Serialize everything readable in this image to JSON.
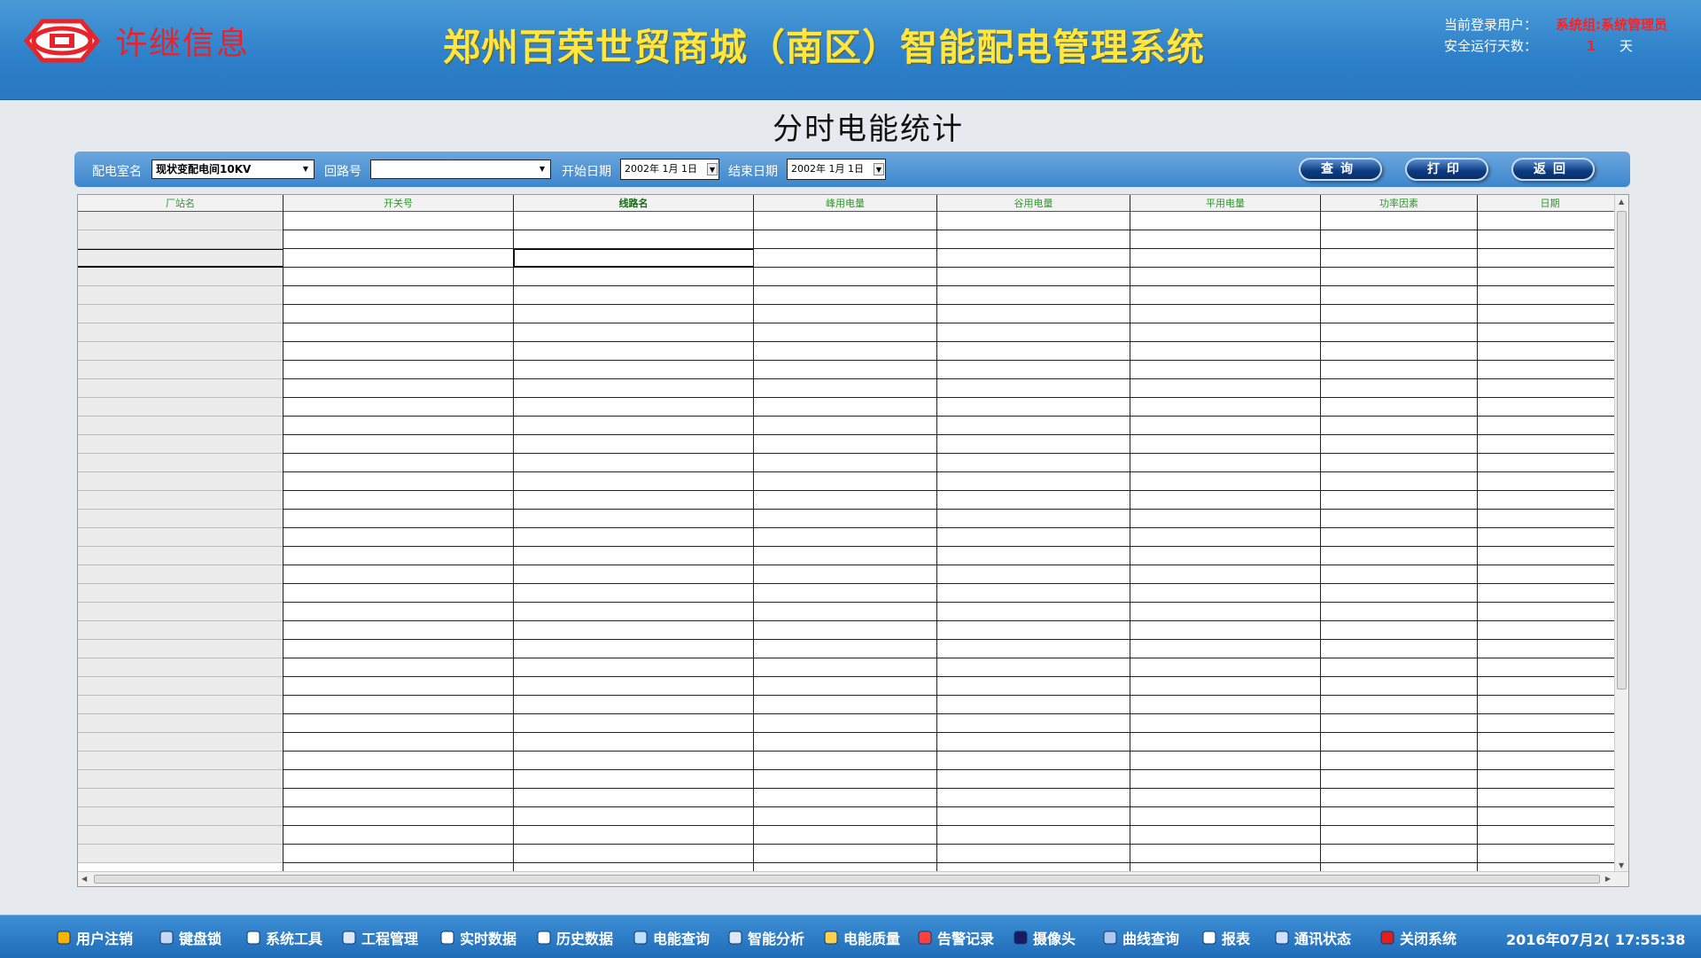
{
  "header": {
    "brand_text": "许继信息",
    "system_title": "郑州百荣世贸商城（南区）智能配电管理系统",
    "login_label": "当前登录用户：",
    "login_value": "系统组:系统管理员",
    "uptime_label": "安全运行天数：",
    "uptime_value": "1",
    "uptime_unit": "天"
  },
  "page_title": "分时电能统计",
  "toolbar": {
    "room_label": "配电室名",
    "room_value": "现状变配电间10KV",
    "circuit_label": "回路号",
    "circuit_value": "",
    "start_label": "开始日期",
    "start_value": "2002年 1月 1日",
    "end_label": "结束日期",
    "end_value": "2002年 1月 1日",
    "query_label": "查询",
    "print_label": "打印",
    "back_label": "返回"
  },
  "table": {
    "columns": [
      "厂站名",
      "开关号",
      "线路名",
      "峰用电量",
      "谷用电量",
      "平用电量",
      "功率因素",
      "日期"
    ]
  },
  "taskbar": {
    "items": [
      {
        "label": "用户注销",
        "icon": "user-icon"
      },
      {
        "label": "键盘锁",
        "icon": "keyboard-icon"
      },
      {
        "label": "系统工具",
        "icon": "tools-icon"
      },
      {
        "label": "工程管理",
        "icon": "project-icon"
      },
      {
        "label": "实时数据",
        "icon": "realtime-icon"
      },
      {
        "label": "历史数据",
        "icon": "history-icon"
      },
      {
        "label": "电能查询",
        "icon": "energy-icon"
      },
      {
        "label": "智能分析",
        "icon": "analysis-icon"
      },
      {
        "label": "电能质量",
        "icon": "quality-icon"
      },
      {
        "label": "告警记录",
        "icon": "alarm-icon"
      },
      {
        "label": "摄像头",
        "icon": "camera-icon"
      },
      {
        "label": "曲线查询",
        "icon": "curve-icon"
      },
      {
        "label": "报表",
        "icon": "report-icon"
      },
      {
        "label": "通讯状态",
        "icon": "network-icon"
      },
      {
        "label": "关闭系统",
        "icon": "close-icon"
      }
    ],
    "clock": "2016年07月2( 17:55:38"
  },
  "colors": {
    "header_blue": "#2c7fc9",
    "title_yellow": "#ffe640",
    "alert_red": "#ff2020",
    "column_green": "#2a9a2a"
  }
}
